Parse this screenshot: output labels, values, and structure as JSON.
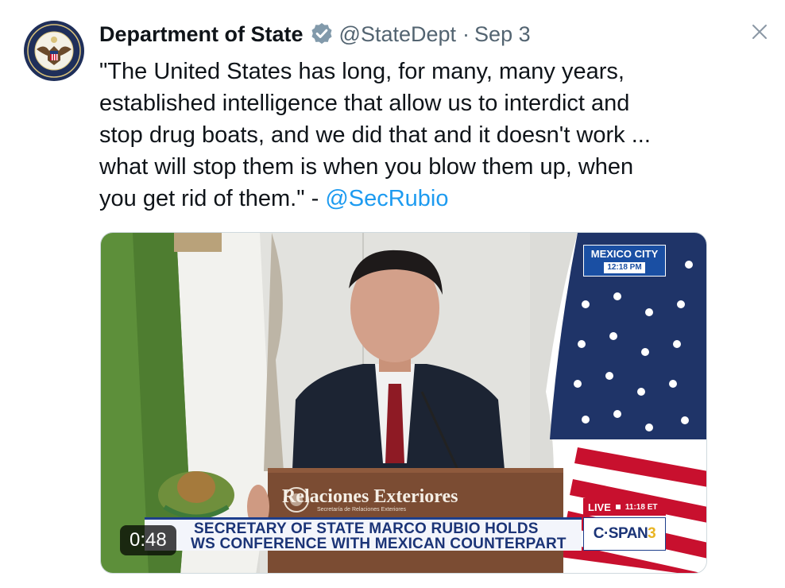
{
  "author": {
    "display_name": "Department of State",
    "handle": "@StateDept",
    "separator": "·",
    "date": "Sep 3"
  },
  "tweet": {
    "lines": [
      "\"The United States has long, for many, many years,",
      "established intelligence that allow us to interdict and",
      "stop drug boats, and we did that and it doesn't work ...",
      "what will stop them is when you blow them up, when"
    ],
    "last_line_text": "you get rid of them.\" - ",
    "mention": "@SecRubio"
  },
  "video": {
    "location": "MEXICO CITY",
    "location_time": "12:18 PM",
    "podium_label": "Relaciones Exteriores",
    "podium_sublabel": "Secretaría de Relaciones Exteriores",
    "chyron_line1": "SECRETARY OF STATE MARCO RUBIO HOLDS",
    "chyron_line2": "WS CONFERENCE WITH MEXICAN COUNTERPART",
    "live_label": "LIVE",
    "live_time": "11:18 ET",
    "network_prefix": "C·SPAN",
    "network_suffix": "3",
    "duration": "0:48"
  },
  "icons": {
    "avatar": "state-department-seal",
    "verified": "verified-badge-icon",
    "close": "close-icon"
  },
  "colors": {
    "link": "#1d9bf0",
    "secondary_text": "#536471",
    "verified_badge": "#829aab"
  }
}
